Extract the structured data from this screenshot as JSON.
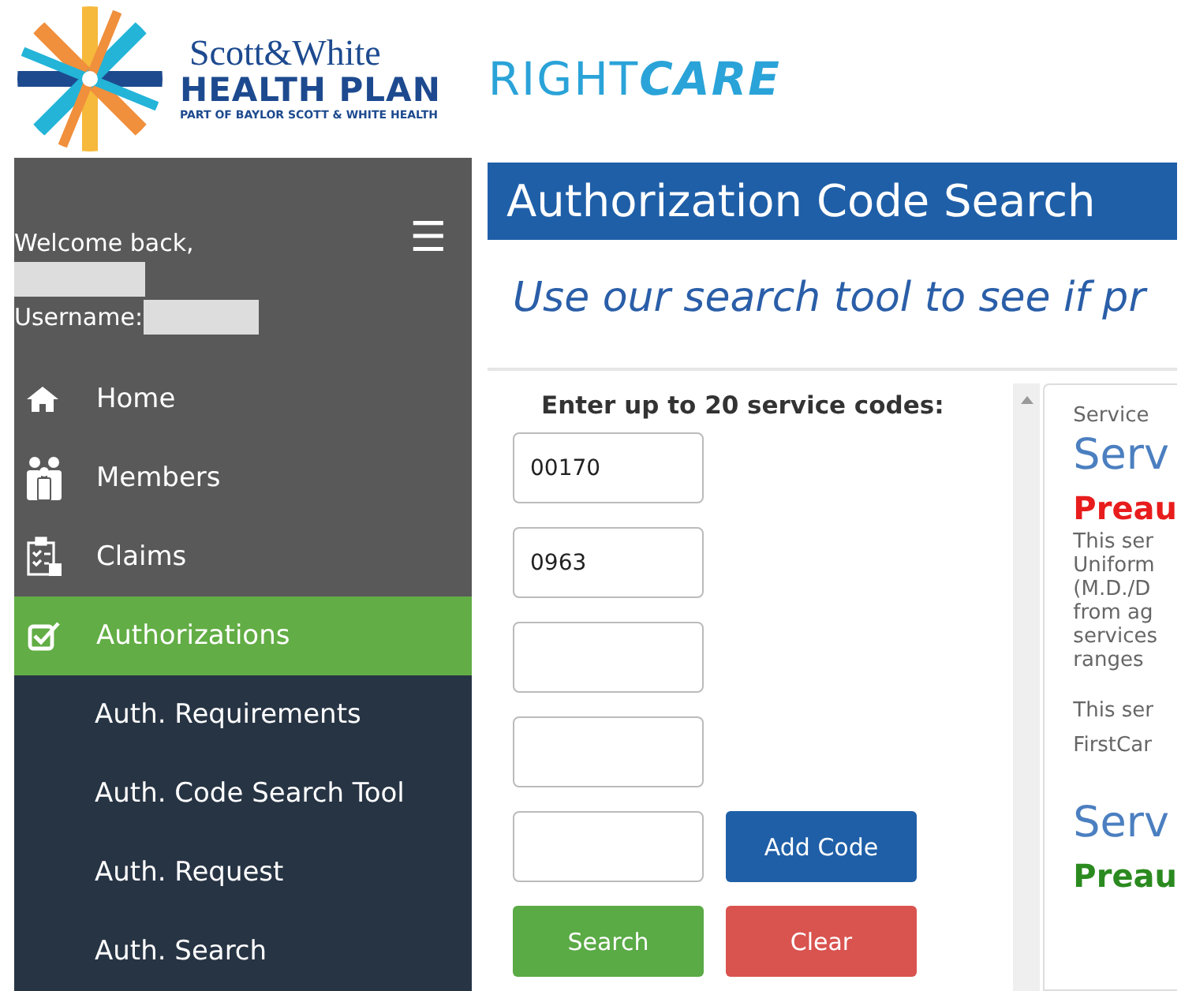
{
  "header": {
    "logo_line1": "Scott&White",
    "logo_line2": "HEALTH PLAN",
    "logo_line3": "PART OF BAYLOR SCOTT & WHITE HEALTH",
    "brand": "RIGHT**CARE**"
  },
  "sidebar": {
    "welcome": "Welcome back,",
    "username_label": "Username:",
    "menu_icon": "☰",
    "items": [
      {
        "kind": "home",
        "label": "Home",
        "selected": false
      },
      {
        "kind": "members",
        "label": "Members",
        "selected": false
      },
      {
        "kind": "claims",
        "label": "Claims",
        "selected": false
      },
      {
        "kind": "authorizations",
        "label": "Authorizations",
        "selected": true,
        "children": [
          {
            "label": "Auth. Requirements"
          },
          {
            "label": "Auth. Code Search Tool"
          },
          {
            "label": "Auth. Request"
          },
          {
            "label": "Auth. Search"
          }
        ]
      }
    ]
  },
  "page": {
    "title": "Authorization Code Search",
    "subtitle": "Use our search tool to see if pr"
  },
  "form": {
    "label": "Enter up to 20 service codes:",
    "codes": [
      {
        "kind": "filled",
        "value": "00170"
      },
      {
        "kind": "filled",
        "value": "0963"
      },
      {
        "kind": "blank"
      },
      {
        "kind": "blank"
      },
      {
        "kind": "blank"
      }
    ],
    "add_button": "Add Code",
    "search_button": "Search",
    "clear_button": "Clear"
  },
  "results": {
    "caption": "Service",
    "services": [
      {
        "heading": "Serv",
        "status": "Preau",
        "color": "#e81c1c",
        "lines": [
          "This ser",
          "Uniform",
          "(M.D./D",
          "from ag",
          "services",
          "ranges"
        ],
        "note": [
          "This ser",
          "FirstCar"
        ]
      },
      {
        "heading": "Serv",
        "status": "Preau",
        "color": "#2b8a1f"
      }
    ]
  }
}
